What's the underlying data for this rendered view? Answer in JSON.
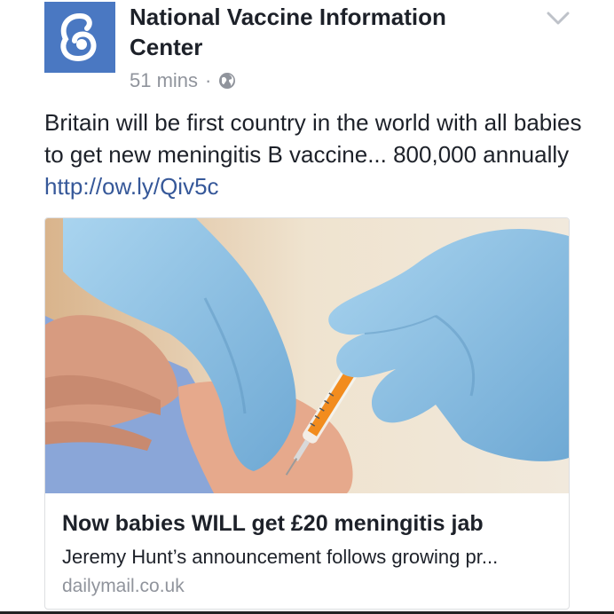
{
  "post": {
    "author": "National Vaccine Information Center",
    "time": "51 mins",
    "separator": "·",
    "privacy_icon": "globe-icon",
    "menu_icon": "chevron-down-icon",
    "text": "Britain will be first country in the world with all babies to get new meningitis B vaccine... 800,000 annually",
    "link": "http://ow.ly/Qiv5c"
  },
  "card": {
    "image": "photo-vaccine-injection",
    "title": "Now babies WILL get £20 meningitis jab",
    "description": "Jeremy Hunt’s announcement follows growing pr...",
    "domain": "dailymail.co.uk"
  },
  "colors": {
    "brand": "#4a78c2",
    "link": "#365899",
    "muted": "#90949c",
    "glove": "#8fc3e6",
    "syringe": "#f28c1e"
  }
}
